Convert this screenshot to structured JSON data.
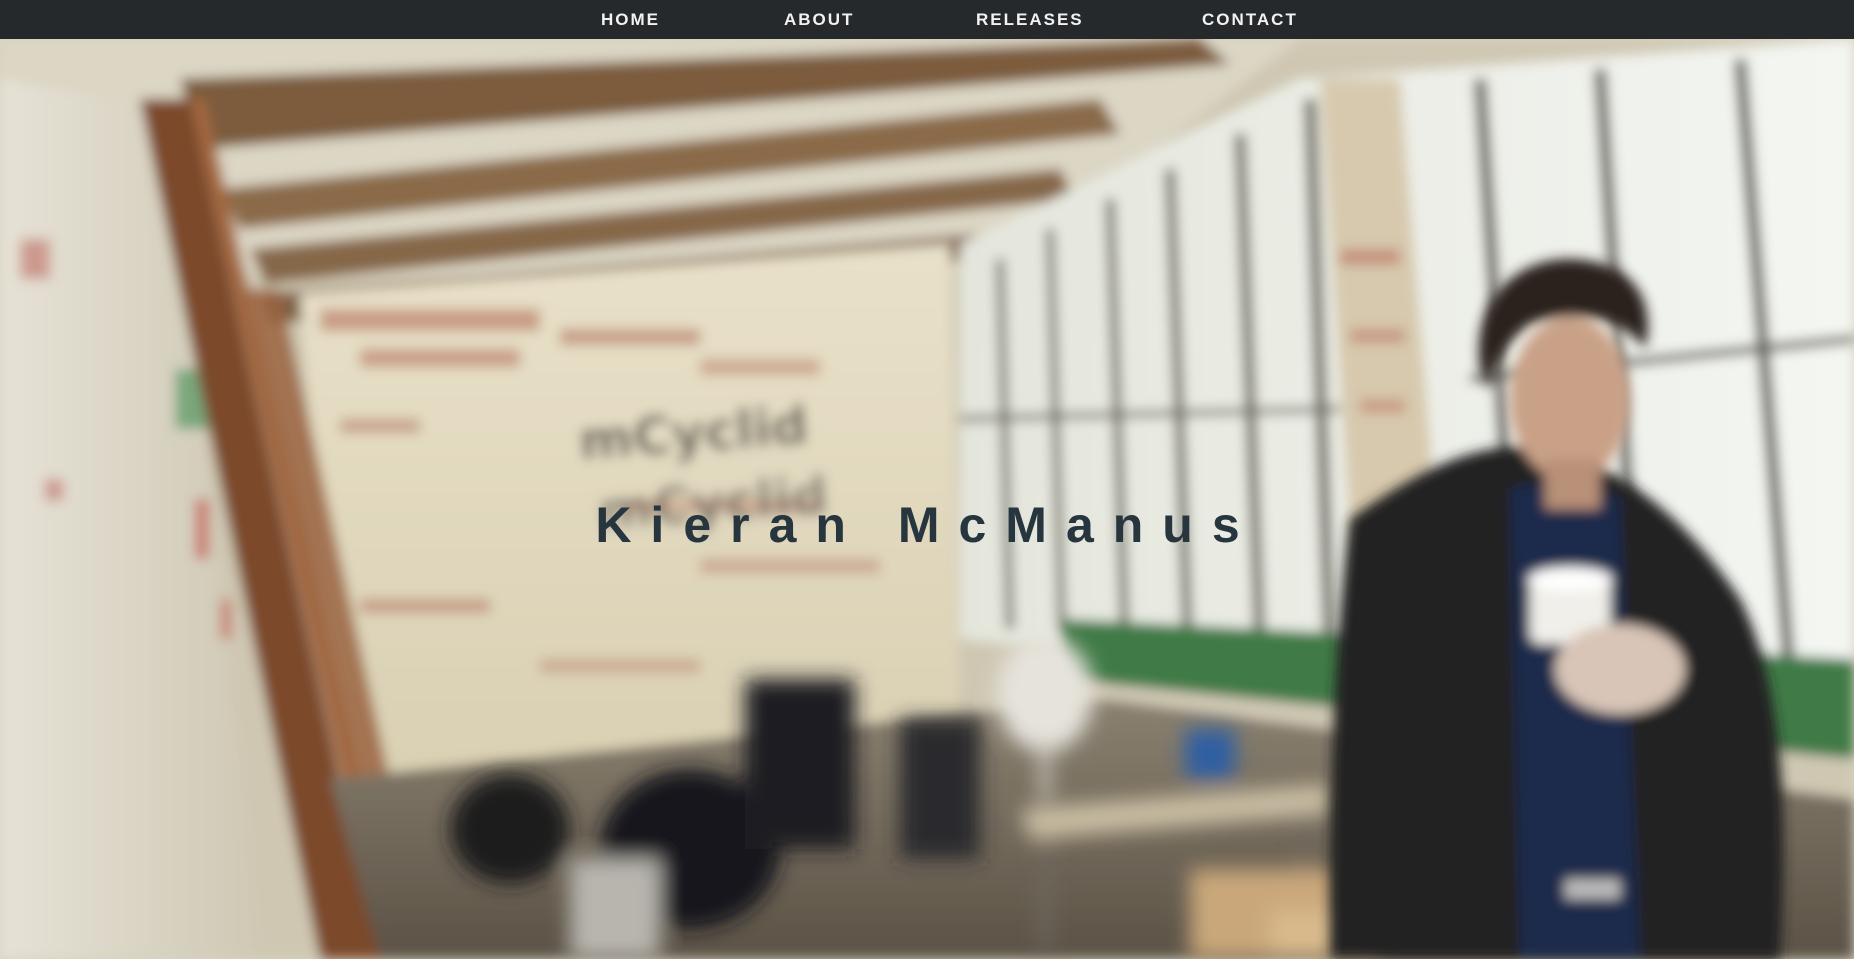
{
  "nav": {
    "items": [
      {
        "label": "HOME"
      },
      {
        "label": "ABOUT"
      },
      {
        "label": "RELEASES"
      },
      {
        "label": "CONTACT"
      }
    ]
  },
  "hero": {
    "title": "Kieran McManus",
    "background": {
      "subject": "person-holding-cup-in-warehouse-photo",
      "wall_text": "mCyclid"
    }
  },
  "colors": {
    "navbar": "#25292c",
    "nav_text": "#f2f2f2",
    "title_text": "#27353f"
  }
}
